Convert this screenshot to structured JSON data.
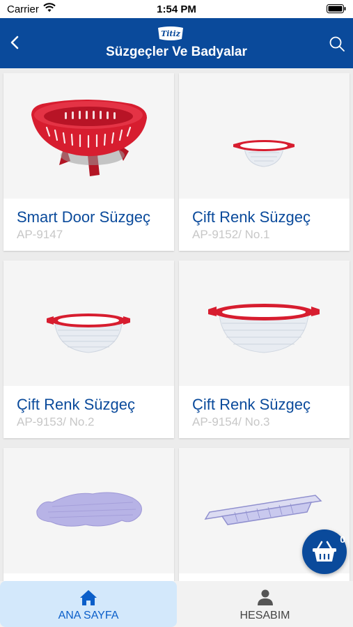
{
  "status_bar": {
    "carrier": "Carrier",
    "time": "1:54 PM"
  },
  "nav": {
    "title": "Süzgeçler Ve Badyalar",
    "logo": "Titiz"
  },
  "products": [
    {
      "name": "Smart Door Süzgeç",
      "code": "AP-9147",
      "icon": "red-colander-icon"
    },
    {
      "name": "Çift Renk Süzgeç",
      "code": "AP-9152/ No.1",
      "icon": "small-colander-icon"
    },
    {
      "name": "Çift Renk Süzgeç",
      "code": "AP-9153/ No.2",
      "icon": "medium-colander-icon"
    },
    {
      "name": "Çift Renk Süzgeç",
      "code": "AP-9154/ No.3",
      "icon": "large-colander-icon"
    },
    {
      "name": "",
      "code": "",
      "icon": "sink-mat-icon"
    },
    {
      "name": "",
      "code": "",
      "icon": "sink-basket-icon"
    }
  ],
  "cart": {
    "count": "0"
  },
  "tabs": {
    "home": "ANA SAYFA",
    "account": "HESABIM"
  },
  "colors": {
    "brand": "#0a4a9b",
    "accent_red": "#d71d2f",
    "mat_purple": "#b7b3e6"
  }
}
